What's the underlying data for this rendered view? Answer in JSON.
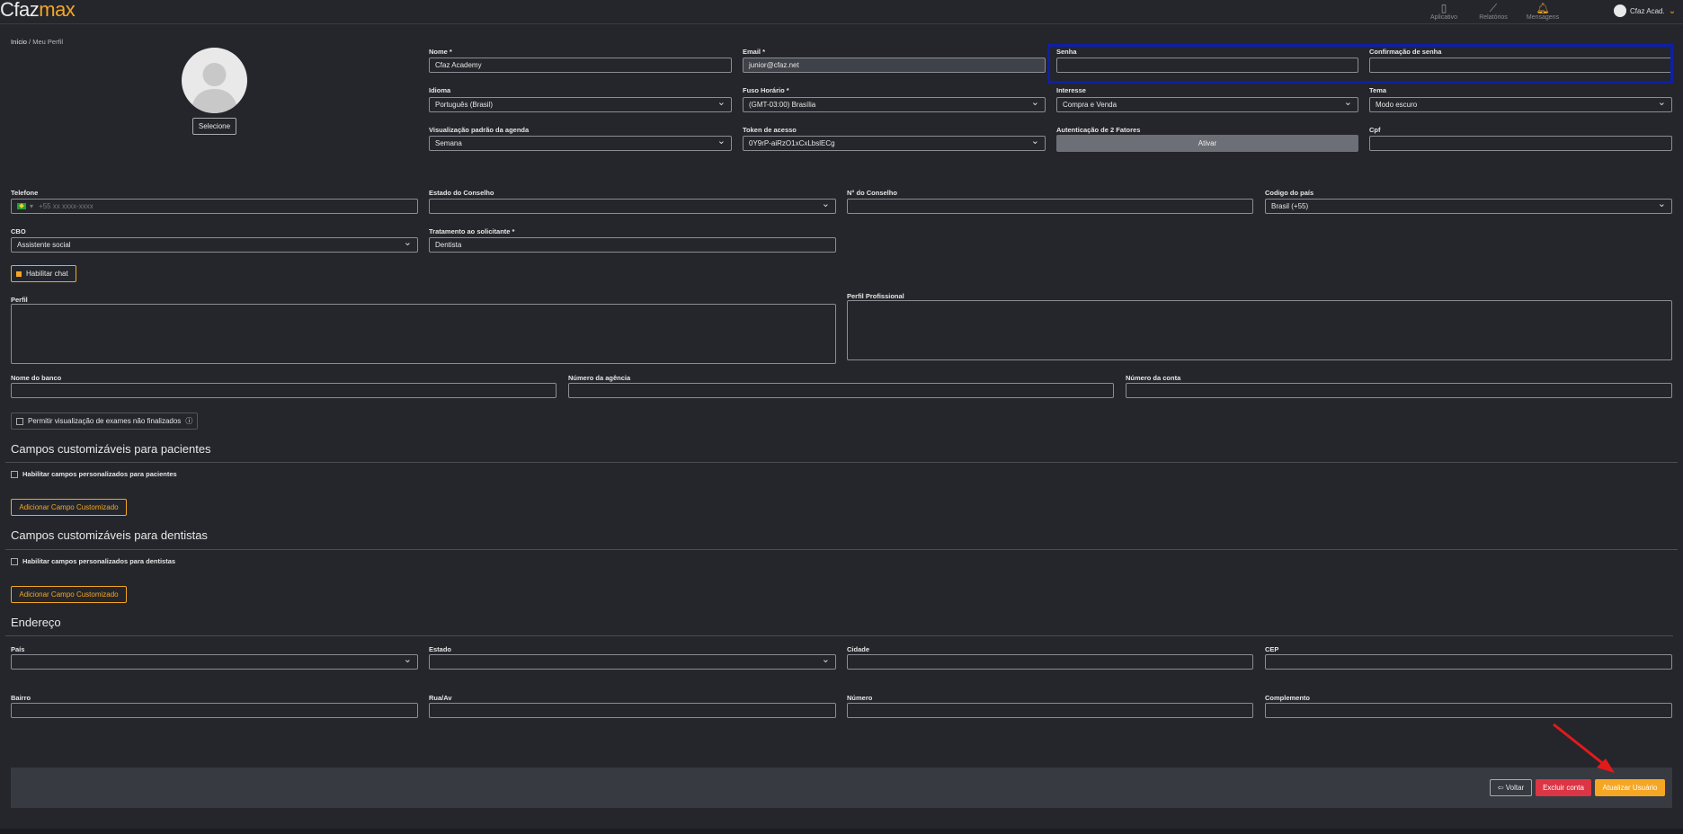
{
  "app": {
    "logo_c": "Cfaz",
    "logo_m": "max"
  },
  "nav": {
    "aplicativo": "Aplicativo",
    "relatorios": "Relatórios",
    "mensagens": "Mensagens",
    "user": "Cfaz Acad."
  },
  "breadcrumb": {
    "home": "Início",
    "sep": "/",
    "current": "Meu Perfil"
  },
  "avatar": {
    "select_label": "Selecione"
  },
  "fields": {
    "nome": {
      "label": "Nome *",
      "value": "Cfaz Academy"
    },
    "email": {
      "label": "Email *",
      "value": "junior@cfaz.net"
    },
    "senha": {
      "label": "Senha",
      "value": ""
    },
    "confirmacao": {
      "label": "Confirmação de senha",
      "value": ""
    },
    "idioma": {
      "label": "Idioma",
      "value": "Português (Brasil)"
    },
    "fuso": {
      "label": "Fuso Horário *",
      "value": "(GMT-03:00) Brasília"
    },
    "interesse": {
      "label": "Interesse",
      "value": "Compra e Venda"
    },
    "tema": {
      "label": "Tema",
      "value": "Modo escuro"
    },
    "visualizacao": {
      "label": "Visualização padrão da agenda",
      "value": "Semana"
    },
    "token": {
      "label": "Token de acesso",
      "value": "0Y9rP-aiRzO1xCxLbslECg"
    },
    "auth2": {
      "label": "Autenticação de 2 Fatores",
      "button": "Ativar"
    },
    "cpf": {
      "label": "Cpf",
      "value": ""
    },
    "telefone": {
      "label": "Telefone",
      "placeholder": "+55 xx xxxx-xxxx"
    },
    "estado_conselho": {
      "label": "Estado do Conselho",
      "value": ""
    },
    "n_conselho": {
      "label": "N° do Conselho",
      "value": ""
    },
    "codigo_pais": {
      "label": "Codigo do país",
      "value": "Brasil (+55)"
    },
    "cbo": {
      "label": "CBO",
      "value": "Assistente social"
    },
    "tratamento": {
      "label": "Tratamento ao solicitante *",
      "value": "Dentista"
    },
    "perfil": {
      "label": "Perfil"
    },
    "perfil_prof": {
      "label": "Perfil Profissional"
    },
    "banco": {
      "label": "Nome do banco"
    },
    "agencia": {
      "label": "Número da agência"
    },
    "conta": {
      "label": "Número da conta"
    }
  },
  "chat_button": "Habilitar chat",
  "permitir_exames": "Permitir visualização de exames não finalizados",
  "info_icon": "ⓘ",
  "sections": {
    "pacientes": {
      "title": "Campos customizáveis para pacientes",
      "checkbox": "Habilitar campos personalizados para pacientes",
      "add": "Adicionar Campo Customizado"
    },
    "dentistas": {
      "title": "Campos customizáveis para dentistas",
      "checkbox": "Habilitar campos personalizados para dentistas",
      "add": "Adicionar Campo Customizado"
    },
    "endereco": {
      "title": "Endereço",
      "pais": "País",
      "estado": "Estado",
      "cidade": "Cidade",
      "cep": "CEP",
      "bairro": "Bairro",
      "rua": "Rua/Av",
      "numero": "Número",
      "complemento": "Complemento"
    }
  },
  "footer": {
    "voltar": "⇦ Voltar",
    "excluir": "Excluir conta",
    "atualizar": "Atualizar Usuário"
  },
  "colors": {
    "accent": "#f5a623",
    "danger": "#dc3545",
    "highlight_box": "#0e1fa8",
    "annotation_arrow": "#e21a1a"
  }
}
